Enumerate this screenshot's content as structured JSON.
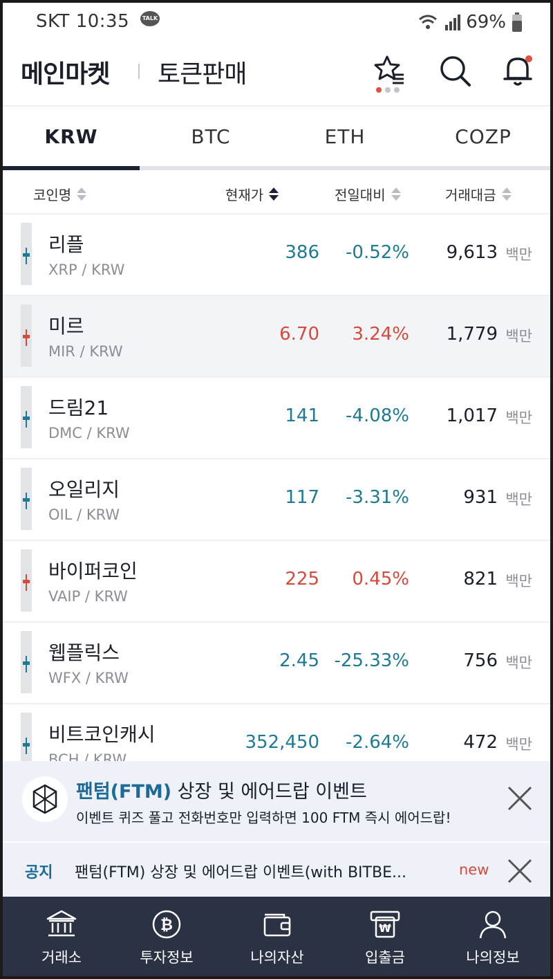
{
  "status": {
    "carrier": "SKT",
    "time": "10:35",
    "talk": "TALK",
    "battery": "69%"
  },
  "header": {
    "title": "메인마켓",
    "token_sale": "토큰판매"
  },
  "tabs": [
    "KRW",
    "BTC",
    "ETH",
    "COZP"
  ],
  "active_tab": "KRW",
  "columns": {
    "name": "코인명",
    "price": "현재가",
    "change": "전일대비",
    "volume": "거래대금"
  },
  "rows": [
    {
      "name": "리플",
      "pair": "XRP / KRW",
      "price": "386",
      "change": "-0.52%",
      "volume": "9,613",
      "unit": "백만",
      "direction": "down"
    },
    {
      "name": "미르",
      "pair": "MIR / KRW",
      "price": "6.70",
      "change": "3.24%",
      "volume": "1,779",
      "unit": "백만",
      "direction": "up"
    },
    {
      "name": "드림21",
      "pair": "DMC / KRW",
      "price": "141",
      "change": "-4.08%",
      "volume": "1,017",
      "unit": "백만",
      "direction": "down"
    },
    {
      "name": "오일리지",
      "pair": "OIL / KRW",
      "price": "117",
      "change": "-3.31%",
      "volume": "931",
      "unit": "백만",
      "direction": "down"
    },
    {
      "name": "바이퍼코인",
      "pair": "VAIP / KRW",
      "price": "225",
      "change": "0.45%",
      "volume": "821",
      "unit": "백만",
      "direction": "up"
    },
    {
      "name": "웹플릭스",
      "pair": "WFX / KRW",
      "price": "2.45",
      "change": "-25.33%",
      "volume": "756",
      "unit": "백만",
      "direction": "down"
    },
    {
      "name": "비트코인캐시",
      "pair": "BCH / KRW",
      "price": "352,450",
      "change": "-2.64%",
      "volume": "472",
      "unit": "백만",
      "direction": "down"
    }
  ],
  "banner": {
    "title_highlight": "팬텀(FTM)",
    "title_rest": " 상장 및 에어드랍 이벤트",
    "subtitle": "이벤트 퀴즈 풀고 전화번호만 입력하면 100 FTM 즉시 에어드랍!"
  },
  "notice": {
    "label": "공지",
    "text": "팬텀(FTM) 상장 및 에어드랍 이벤트(with BITBE...",
    "badge": "new"
  },
  "nav": [
    {
      "label": "거래소",
      "icon": "bank-icon"
    },
    {
      "label": "투자정보",
      "icon": "bitcoin-icon"
    },
    {
      "label": "나의자산",
      "icon": "wallet-icon"
    },
    {
      "label": "입출금",
      "icon": "won-deposit-icon"
    },
    {
      "label": "나의정보",
      "icon": "user-icon"
    }
  ],
  "colors": {
    "down": "#1d7a94",
    "up": "#d64a3b",
    "nav_bg": "#2a3244",
    "accent": "#1d6a98"
  }
}
